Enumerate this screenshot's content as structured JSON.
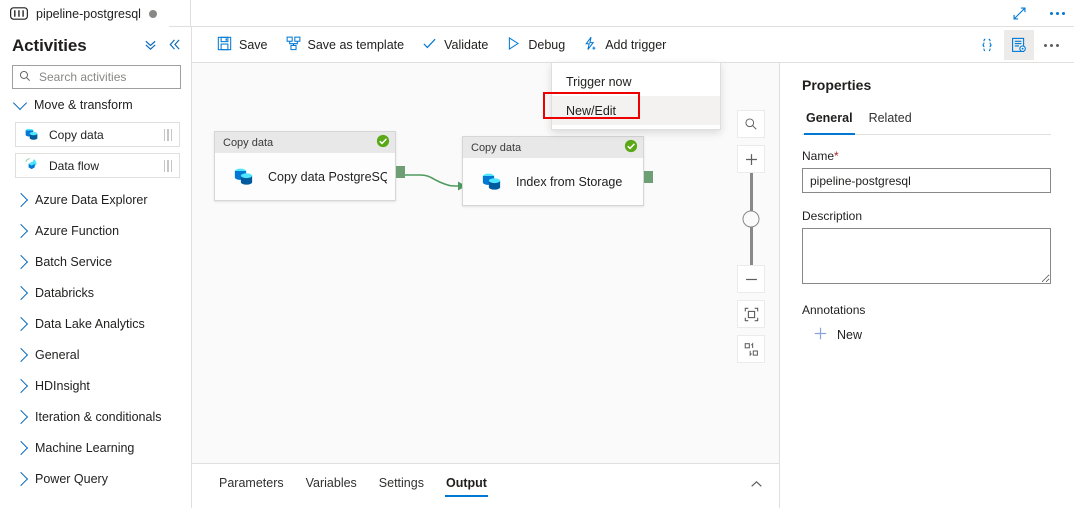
{
  "tabstrip": {
    "pipeline_tab_label": "pipeline-postgresql",
    "pipeline_icon": "pipeline-icon",
    "dirty_indicator": "unsaved-changes-dot",
    "expand_icon": "expand-diagonal-icon",
    "more_icon": "ellipsis-icon"
  },
  "activities": {
    "title": "Activities",
    "collapse_all_icon": "double-chevron-down-icon",
    "collapse_panel_icon": "double-chevron-left-icon",
    "search": {
      "placeholder": "Search activities",
      "value": "",
      "icon": "search-icon"
    },
    "groups": [
      {
        "label": "Move & transform",
        "expanded": true
      },
      {
        "label": "Azure Data Explorer",
        "expanded": false
      },
      {
        "label": "Azure Function",
        "expanded": false
      },
      {
        "label": "Batch Service",
        "expanded": false
      },
      {
        "label": "Databricks",
        "expanded": false
      },
      {
        "label": "Data Lake Analytics",
        "expanded": false
      },
      {
        "label": "General",
        "expanded": false
      },
      {
        "label": "HDInsight",
        "expanded": false
      },
      {
        "label": "Iteration & conditionals",
        "expanded": false
      },
      {
        "label": "Machine Learning",
        "expanded": false
      },
      {
        "label": "Power Query",
        "expanded": false
      }
    ],
    "items": [
      {
        "label": "Copy data",
        "icon": "copy-data-icon"
      },
      {
        "label": "Data flow",
        "icon": "data-flow-icon"
      }
    ]
  },
  "toolbar": {
    "save_label": "Save",
    "save_template_label": "Save as template",
    "validate_label": "Validate",
    "debug_label": "Debug",
    "add_trigger_label": "Add trigger",
    "code_icon": "code-braces-icon",
    "properties_icon": "properties-panel-icon",
    "more_icon": "ellipsis-icon"
  },
  "trigger_menu": {
    "items": [
      {
        "label": "Trigger now",
        "hover": false,
        "highlighted": false
      },
      {
        "label": "New/Edit",
        "hover": true,
        "highlighted": true
      }
    ],
    "highlight_color": "#ee0000"
  },
  "canvas": {
    "nodes": [
      {
        "type_label": "Copy data",
        "name": "Copy data PostgreSQL",
        "status": "success",
        "icon": "copy-data-icon"
      },
      {
        "type_label": "Copy data",
        "name": "Index from Storage",
        "status": "success",
        "icon": "copy-data-icon"
      }
    ],
    "connection_color": "#4e9a5f",
    "controls": [
      {
        "name": "zoom-to-search",
        "icon": "magnifier-icon"
      },
      {
        "name": "zoom-in",
        "icon": "plus-icon"
      },
      {
        "name": "zoom-slider",
        "icon": "slider-icon"
      },
      {
        "name": "zoom-out",
        "icon": "minus-icon"
      },
      {
        "name": "fit-to-screen",
        "icon": "fit-screen-icon"
      },
      {
        "name": "auto-align",
        "icon": "auto-align-icon"
      }
    ]
  },
  "bottom_panel": {
    "tabs": [
      {
        "label": "Parameters",
        "active": false
      },
      {
        "label": "Variables",
        "active": false
      },
      {
        "label": "Settings",
        "active": false
      },
      {
        "label": "Output",
        "active": true
      }
    ],
    "expand_icon": "chevron-up-icon"
  },
  "properties": {
    "title": "Properties",
    "tabs": [
      {
        "label": "General",
        "active": true
      },
      {
        "label": "Related",
        "active": false
      }
    ],
    "name_label": "Name",
    "name_required_marker": "*",
    "name_value": "pipeline-postgresql",
    "name_placeholder": "",
    "description_label": "Description",
    "description_value": "",
    "description_placeholder": "",
    "annotations_label": "Annotations",
    "add_new_label": "New",
    "add_icon": "plus-icon"
  },
  "colors": {
    "accent": "#0078d4",
    "success": "#5aa816",
    "required": "#a4262c",
    "highlight": "#ee0000",
    "canvas_bg": "#fafafa"
  }
}
